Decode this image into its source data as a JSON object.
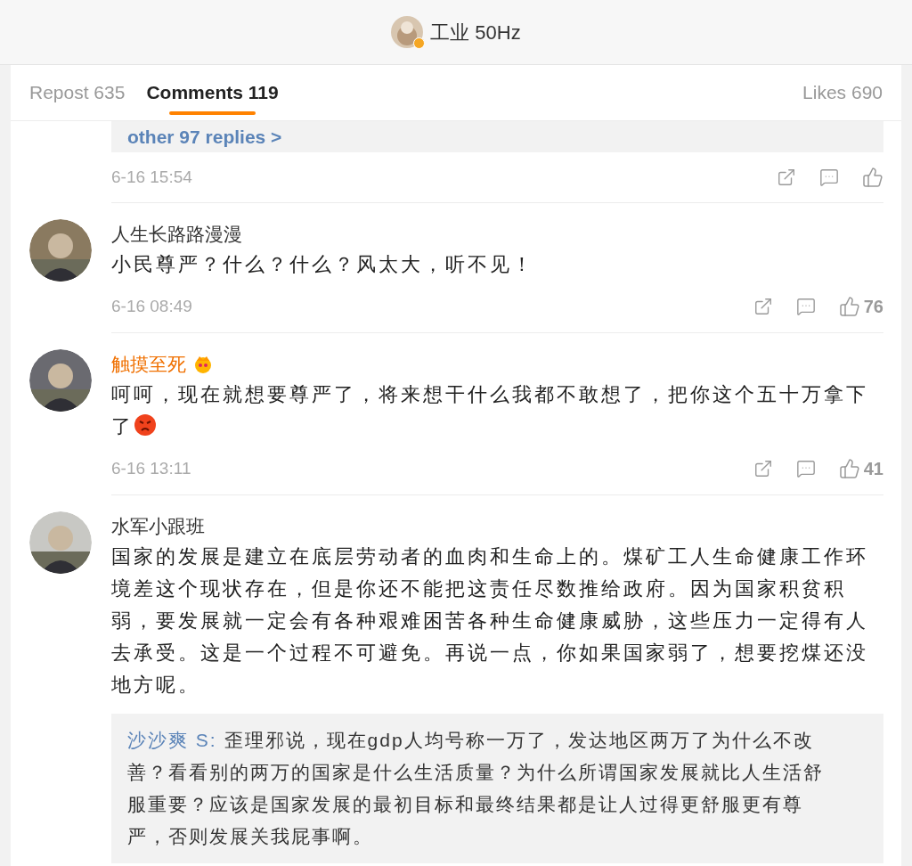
{
  "header": {
    "title": "工业 50Hz",
    "verified": true
  },
  "tabs": [
    {
      "label": "Repost 635",
      "selected": false
    },
    {
      "label": "Comments 119",
      "selected": true
    },
    {
      "label": "Likes 690",
      "selected": false
    }
  ],
  "previous_comment": {
    "more_replies": "other 97 replies >",
    "time": "6-16 15:54"
  },
  "comments": [
    {
      "author": "人生长路路漫漫",
      "vip": false,
      "text": "小民尊严？什么？什么？风太大，听不见！",
      "trailing_emoji": false,
      "time": "6-16 08:49",
      "likes": "76"
    },
    {
      "author": "触摸至死",
      "vip": true,
      "text": "呵呵，现在就想要尊严了，将来想干什么我都不敢想了，把你这个五十万拿下了",
      "trailing_emoji": true,
      "time": "6-16 13:11",
      "likes": "41"
    },
    {
      "author": "水军小跟班",
      "vip": false,
      "text": "国家的发展是建立在底层劳动者的血肉和生命上的。煤矿工人生命健康工作环境差这个现状存在，但是你还不能把这责任尽数推给政府。因为国家积贫积弱，要发展就一定会有各种艰难困苦各种生命健康威胁，这些压力一定得有人去承受。这是一个过程不可避免。再说一点，你如果国家弱了，想要挖煤还没地方呢。",
      "trailing_emoji": false,
      "reply": {
        "author": "沙沙爽 S:",
        "text": "歪理邪说，现在gdp人均号称一万了，发达地区两万了为什么不改善？看看别的两万的国家是什么生活质量？为什么所谓国家发展就比人生活舒服重要？应该是国家发展的最初目标和最终结果都是让人过得更舒服更有尊严，否则发展关我屁事啊。"
      }
    }
  ]
}
